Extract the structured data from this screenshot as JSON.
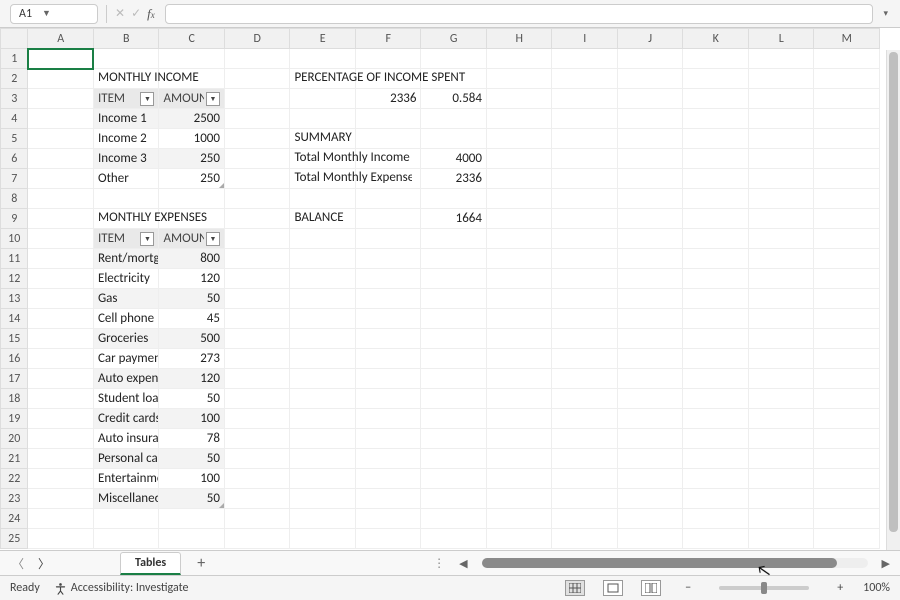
{
  "activeCell": "A1",
  "columns": [
    "A",
    "B",
    "C",
    "D",
    "E",
    "F",
    "G",
    "H",
    "I",
    "J",
    "K",
    "L",
    "M"
  ],
  "sheet": {
    "tab": "Tables",
    "rowsVisible": 25
  },
  "income": {
    "title": "MONTHLY INCOME",
    "headers": {
      "item": "ITEM",
      "amount": "AMOUNT"
    },
    "rows": [
      {
        "item": "Income 1",
        "amount": "2500"
      },
      {
        "item": "Income 2",
        "amount": "1000"
      },
      {
        "item": "Income 3",
        "amount": "250"
      },
      {
        "item": "Other",
        "amount": "250"
      }
    ]
  },
  "expenses": {
    "title": "MONTHLY EXPENSES",
    "headers": {
      "item": "ITEM",
      "amount": "AMOUNT"
    },
    "rows": [
      {
        "item": "Rent/mortgage",
        "amount": "800"
      },
      {
        "item": "Electricity",
        "amount": "120"
      },
      {
        "item": "Gas",
        "amount": "50"
      },
      {
        "item": "Cell phone",
        "amount": "45"
      },
      {
        "item": "Groceries",
        "amount": "500"
      },
      {
        "item": "Car payment",
        "amount": "273"
      },
      {
        "item": "Auto expenses",
        "amount": "120"
      },
      {
        "item": "Student loans",
        "amount": "50"
      },
      {
        "item": "Credit cards",
        "amount": "100"
      },
      {
        "item": "Auto insurance",
        "amount": "78"
      },
      {
        "item": "Personal care",
        "amount": "50"
      },
      {
        "item": "Entertainment",
        "amount": "100"
      },
      {
        "item": "Miscellaneous",
        "amount": "50"
      }
    ]
  },
  "percent": {
    "title": "PERCENTAGE OF INCOME SPENT",
    "valueA": "2336",
    "valueB": "0.584"
  },
  "summary": {
    "title": "SUMMARY",
    "rows": [
      {
        "label": "Total Monthly Income",
        "value": "4000"
      },
      {
        "label": "Total Monthly Expenses",
        "value": "2336"
      }
    ],
    "balanceLabel": "BALANCE",
    "balanceValue": "1664"
  },
  "status": {
    "ready": "Ready",
    "accessibility": "Accessibility: Investigate",
    "zoom": "100%"
  }
}
